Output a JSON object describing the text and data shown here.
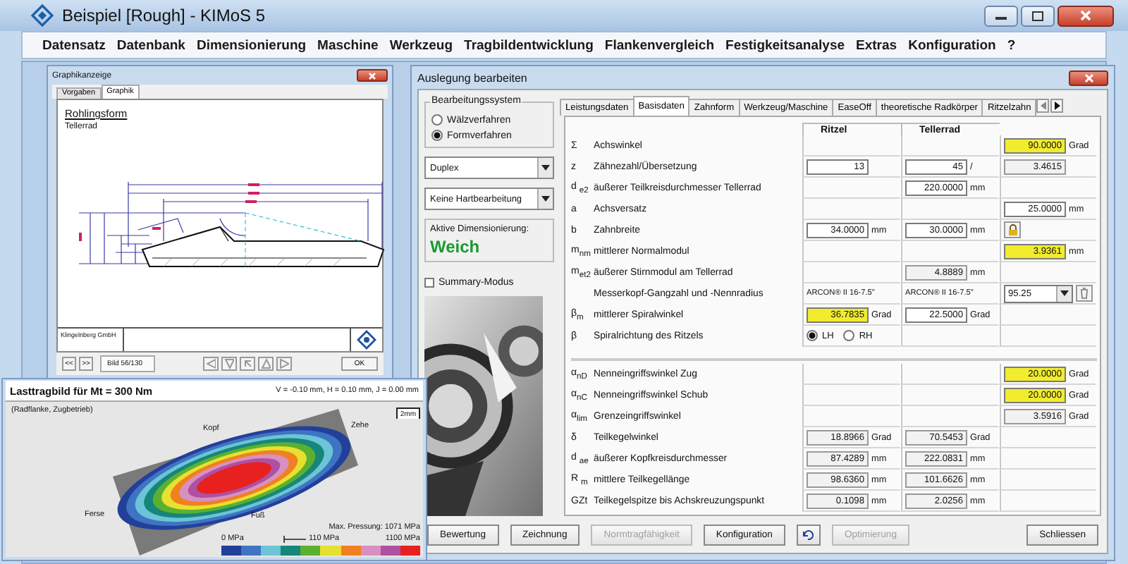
{
  "window": {
    "title": "Beispiel [Rough] - KIMoS 5"
  },
  "menu": [
    "Datensatz",
    "Datenbank",
    "Dimensionierung",
    "Maschine",
    "Werkzeug",
    "Tragbildentwicklung",
    "Flankenvergleich",
    "Festigkeitsanalyse",
    "Extras",
    "Konfiguration",
    "?"
  ],
  "graphics_window": {
    "title": "Graphikanzeige",
    "tabs": [
      {
        "label": "Vorgaben",
        "selected": false
      },
      {
        "label": "Graphik",
        "selected": true
      }
    ],
    "heading": "Rohlingsform",
    "subheading": "Tellerrad",
    "footer": "Klingelnberg GmbH",
    "nav_buttons": [
      "<<",
      ">>"
    ],
    "page": "Bild 56/130",
    "ok": "OK"
  },
  "load_pattern": {
    "title": "Lasttragbild für Mt = 300 Nm",
    "offsets": "V = -0.10 mm, H = 0.10 mm, J = 0.00 mm",
    "subtitle": "(Radflanke, Zugbetrieb)",
    "scale": "2mm",
    "labels": {
      "top": "Kopf",
      "toe": "Zehe",
      "heel": "Ferse",
      "root": "Fuß"
    },
    "legend": {
      "min": "0 MPa",
      "step": "110 MPa",
      "max_pressure": "Max. Pressung: 1071 MPa",
      "max": "1100 MPa",
      "colors": [
        {
          "color": "#22409a"
        },
        {
          "color": "#3f74c2"
        },
        {
          "color": "#6cc4d6"
        },
        {
          "color": "#16867a"
        },
        {
          "color": "#5cb030"
        },
        {
          "color": "#e8e030"
        },
        {
          "color": "#f08020"
        },
        {
          "color": "#d890c0"
        },
        {
          "color": "#b050a0"
        },
        {
          "color": "#e82020"
        }
      ]
    }
  },
  "dialog": {
    "title": "Auslegung bearbeiten",
    "process_group": {
      "title": "Bearbeitungssystem",
      "options": [
        {
          "label": "Wälzverfahren",
          "selected": false
        },
        {
          "label": "Formverfahren",
          "selected": true
        }
      ]
    },
    "selects": [
      "Duplex",
      "Keine Hartbearbeitung"
    ],
    "active_label": "Aktive Dimensionierung:",
    "active_value": "Weich",
    "summary": {
      "label": "Summary-Modus",
      "checked": false
    },
    "tabs": [
      {
        "label": "Leistungsdaten",
        "selected": false
      },
      {
        "label": "Basisdaten",
        "selected": true
      },
      {
        "label": "Zahnform",
        "selected": false
      },
      {
        "label": "Werkzeug/Maschine",
        "selected": false
      },
      {
        "label": "EaseOff",
        "selected": false
      },
      {
        "label": "theoretische Radkörper",
        "selected": false
      },
      {
        "label": "Ritzelzahn",
        "selected": false
      }
    ],
    "columns": [
      "Ritzel",
      "Tellerrad"
    ],
    "rows": [
      {
        "kind": "values",
        "symbol": "Σ",
        "label": "Achswinkel",
        "extra": {
          "kind": "highlight",
          "value": "90.0000",
          "unit": "Grad"
        }
      },
      {
        "kind": "values",
        "symbol": "z",
        "label": "Zähnezahl/Übersetzung",
        "pinion": {
          "kind": "input",
          "value": "13"
        },
        "gear": {
          "kind": "input",
          "value": "45",
          "unit": "/"
        },
        "extra": {
          "kind": "readonly",
          "value": "3.4615"
        }
      },
      {
        "kind": "values",
        "symbol": "d $_{e2}$",
        "label": "äußerer Teilkreisdurchmesser Tellerrad",
        "gear": {
          "kind": "input",
          "value": "220.0000",
          "unit": "mm"
        }
      },
      {
        "kind": "values",
        "symbol": "a",
        "label": "Achsversatz",
        "extra": {
          "kind": "input",
          "value": "25.0000",
          "unit": "mm"
        }
      },
      {
        "kind": "values",
        "symbol": "b",
        "label": "Zahnbreite",
        "pinion": {
          "kind": "input",
          "value": "34.0000",
          "unit": "mm"
        },
        "gear": {
          "kind": "input",
          "value": "30.0000",
          "unit": "mm"
        },
        "extra": {
          "kind": "lock"
        }
      },
      {
        "kind": "values",
        "symbol": "m$_{nm}$",
        "label": "mittlerer Normalmodul",
        "extra": {
          "kind": "highlight",
          "value": "3.9361",
          "unit": "mm"
        }
      },
      {
        "kind": "values",
        "symbol": "m$_{et2}$",
        "label": "äußerer Stirnmodul am Tellerrad",
        "gear": {
          "kind": "readonly",
          "value": "4.8889",
          "unit": "mm"
        }
      },
      {
        "kind": "values",
        "label": "Messerkopf-Gangzahl und -Nennradius",
        "pinion": {
          "kind": "text",
          "value": "ARCON® II 16-7.5\""
        },
        "gear": {
          "kind": "text",
          "value": "ARCON® II 16-7.5\""
        },
        "extra": {
          "kind": "combo",
          "value": "95.25"
        }
      },
      {
        "kind": "values",
        "symbol": "β$_{m}$",
        "label": "mittlerer Spiralwinkel",
        "pinion": {
          "kind": "highlight",
          "value": "36.7835",
          "unit": "Grad"
        },
        "gear": {
          "kind": "input",
          "value": "22.5000",
          "unit": "Grad"
        }
      },
      {
        "kind": "values",
        "symbol": "β",
        "label": "Spiralrichtung des Ritzels",
        "pinion": {
          "kind": "radio",
          "options": [
            {
              "label": "LH",
              "selected": true
            },
            {
              "label": "RH",
              "selected": false
            }
          ]
        }
      },
      {
        "kind": "separator"
      },
      {
        "kind": "values",
        "symbol": "α$_{nD}$",
        "label": "Nenneingriffswinkel Zug",
        "extra": {
          "kind": "highlight",
          "value": "20.0000",
          "unit": "Grad"
        }
      },
      {
        "kind": "values",
        "symbol": "α$_{nC}$",
        "label": "Nenneingriffswinkel Schub",
        "extra": {
          "kind": "highlight",
          "value": "20.0000",
          "unit": "Grad"
        }
      },
      {
        "kind": "values",
        "symbol": "α$_{lim}$",
        "label": "Grenzeingriffswinkel",
        "extra": {
          "kind": "readonly",
          "value": "3.5916",
          "unit": "Grad"
        }
      },
      {
        "kind": "values",
        "symbol": "δ",
        "label": "Teilkegelwinkel",
        "pinion": {
          "kind": "readonly",
          "value": "18.8966",
          "unit": "Grad"
        },
        "gear": {
          "kind": "readonly",
          "value": "70.5453",
          "unit": "Grad"
        }
      },
      {
        "kind": "values",
        "symbol": "d $_{ae}$",
        "label": "äußerer Kopfkreisdurchmesser",
        "pinion": {
          "kind": "readonly",
          "value": "87.4289",
          "unit": "mm"
        },
        "gear": {
          "kind": "readonly",
          "value": "222.0831",
          "unit": "mm"
        }
      },
      {
        "kind": "values",
        "symbol": "R $_{m}$",
        "label": "mittlere Teilkegellänge",
        "pinion": {
          "kind": "readonly",
          "value": "98.6360",
          "unit": "mm"
        },
        "gear": {
          "kind": "readonly",
          "value": "101.6626",
          "unit": "mm"
        }
      },
      {
        "kind": "values",
        "symbol": "GZt",
        "label": "Teilkegelspitze bis Achskreuzungspunkt",
        "pinion": {
          "kind": "readonly",
          "value": "0.1098",
          "unit": "mm"
        },
        "gear": {
          "kind": "readonly",
          "value": "2.0256",
          "unit": "mm"
        }
      }
    ],
    "buttons": [
      {
        "kind": "text",
        "label": "Bewertung",
        "disabled": false
      },
      {
        "kind": "text",
        "label": "Zeichnung",
        "disabled": false
      },
      {
        "kind": "text",
        "label": "Normtragfähigkeit",
        "disabled": true
      },
      {
        "kind": "text",
        "label": "Konfiguration",
        "disabled": false
      },
      {
        "kind": "icon",
        "disabled": false
      },
      {
        "kind": "text",
        "label": "Optimierung",
        "disabled": true
      },
      {
        "kind": "text",
        "label": "Schliessen",
        "disabled": false
      }
    ]
  }
}
